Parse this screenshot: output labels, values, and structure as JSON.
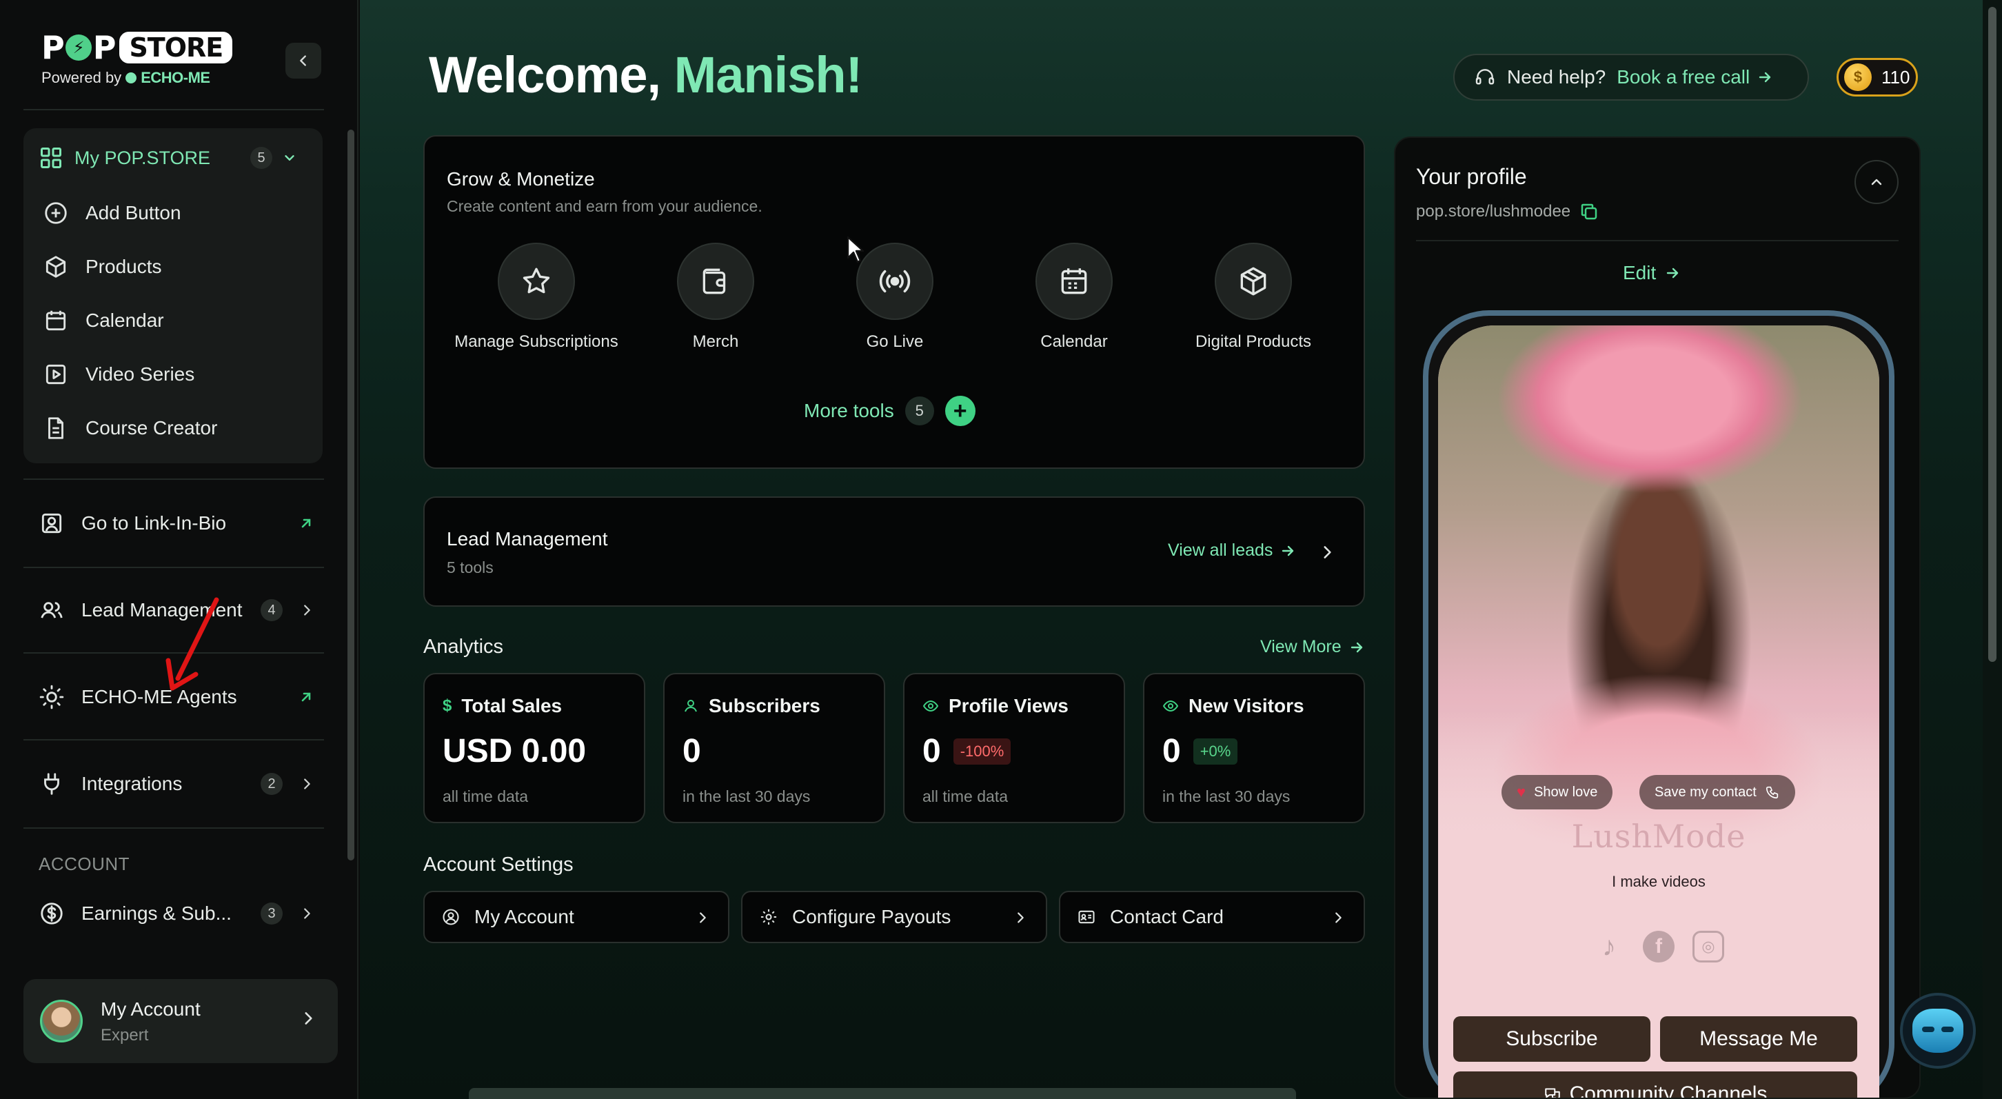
{
  "sidebar": {
    "logo": {
      "pop": "P P",
      "store": "STORE",
      "powered_by": "Powered by",
      "brand": "ECHO-ME"
    },
    "menu": {
      "title": "My POP.STORE",
      "count": "5",
      "items": [
        {
          "label": "Add Button",
          "icon": "plus-circle-icon"
        },
        {
          "label": "Products",
          "icon": "box-icon"
        },
        {
          "label": "Calendar",
          "icon": "calendar-icon"
        },
        {
          "label": "Video Series",
          "icon": "play-square-icon"
        },
        {
          "label": "Course Creator",
          "icon": "document-icon"
        }
      ]
    },
    "link_in_bio": "Go to Link-In-Bio",
    "lead_management": {
      "label": "Lead Management",
      "count": "4"
    },
    "echo_agents": "ECHO-ME Agents",
    "integrations": {
      "label": "Integrations",
      "count": "2"
    },
    "account_section": "ACCOUNT",
    "earnings": {
      "label": "Earnings & Sub...",
      "count": "3"
    },
    "account": {
      "name": "My Account",
      "role": "Expert"
    }
  },
  "header": {
    "welcome": "Welcome,",
    "user_name": "Manish!",
    "help_question": "Need help?",
    "help_link": "Book a free call",
    "coins": "110"
  },
  "grow": {
    "title": "Grow & Monetize",
    "subtitle": "Create content and earn from your audience.",
    "tools": [
      {
        "label": "Manage Subscriptions",
        "icon": "star-icon"
      },
      {
        "label": "Merch",
        "icon": "wallet-icon"
      },
      {
        "label": "Go Live",
        "icon": "broadcast-icon"
      },
      {
        "label": "Calendar",
        "icon": "calendar-icon"
      },
      {
        "label": "Digital Products",
        "icon": "package-icon"
      }
    ],
    "more_tools": "More tools",
    "more_count": "5"
  },
  "leads": {
    "title": "Lead Management",
    "subtitle": "5 tools",
    "link": "View all leads"
  },
  "analytics": {
    "title": "Analytics",
    "view_more": "View More",
    "stats": [
      {
        "label": "Total Sales",
        "icon": "dollar-icon",
        "value": "USD 0.00",
        "delta": "",
        "foot": "all time data"
      },
      {
        "label": "Subscribers",
        "icon": "user-icon",
        "value": "0",
        "delta": "",
        "foot": "in the last 30 days"
      },
      {
        "label": "Profile Views",
        "icon": "eye-icon",
        "value": "0",
        "delta": "-100%",
        "foot": "all time data"
      },
      {
        "label": "New Visitors",
        "icon": "eye-icon",
        "value": "0",
        "delta": "+0%",
        "foot": "in the last 30 days"
      }
    ]
  },
  "account_settings": {
    "title": "Account Settings",
    "buttons": [
      {
        "label": "My Account",
        "icon": "user-circle-icon"
      },
      {
        "label": "Configure Payouts",
        "icon": "gear-icon"
      },
      {
        "label": "Contact Card",
        "icon": "id-card-icon"
      }
    ]
  },
  "profile": {
    "title": "Your profile",
    "url": "pop.store/lushmodee",
    "edit": "Edit",
    "preview": {
      "show_love": "Show love",
      "save_contact": "Save my contact",
      "brand": "LushMode",
      "bio": "I make videos",
      "socials": [
        "tiktok",
        "facebook",
        "instagram"
      ],
      "subscribe": "Subscribe",
      "message": "Message Me",
      "community": "Community Channels"
    }
  },
  "colors": {
    "accent": "#7fe8b4",
    "brand_green": "#3fd184",
    "negative": "#ff6b6b",
    "coin": "#d9a21b"
  }
}
